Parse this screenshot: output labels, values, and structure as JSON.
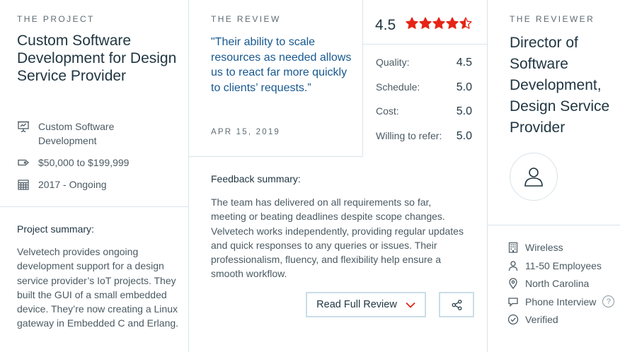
{
  "project": {
    "label": "THE PROJECT",
    "title": "Custom Software Development for Design Service Provider",
    "service": "Custom Software Development",
    "budget": "$50,000 to $199,999",
    "timeline": "2017 - Ongoing",
    "summary_title": "Project summary:",
    "summary_text": "Velvetech provides ongoing development support for a design service provider’s IoT projects. They built the GUI of a small embedded device. They’re now creating a Linux gateway in Embedded C and Erlang."
  },
  "review": {
    "label": "THE REVIEW",
    "quote": "\"Their ability to scale resources as needed allows us to react far more quickly to clients’ requests.”",
    "date": "APR 15, 2019",
    "overall": "4.5",
    "stars": 4.5,
    "star_color": "#e62415",
    "ratings": [
      {
        "label": "Quality:",
        "value": "4.5"
      },
      {
        "label": "Schedule:",
        "value": "5.0"
      },
      {
        "label": "Cost:",
        "value": "5.0"
      },
      {
        "label": "Willing to refer:",
        "value": "5.0"
      }
    ],
    "feedback_title": "Feedback summary:",
    "feedback_text": "The team has delivered on all requirements so far, meeting or beating deadlines despite scope changes. Velvetech works independently, providing regular updates and quick responses to any queries or issues. Their professionalism, fluency, and flexibility help ensure a smooth workflow.",
    "read_full_label": "Read Full Review",
    "chevron_color": "#e62415"
  },
  "reviewer": {
    "label": "THE REVIEWER",
    "title": "Director of Software Development, Design Service Provider",
    "industry": "Wireless",
    "size": "11-50 Employees",
    "location": "North Carolina",
    "review_type": "Phone Interview",
    "help_mark": "?",
    "verified": "Verified"
  }
}
